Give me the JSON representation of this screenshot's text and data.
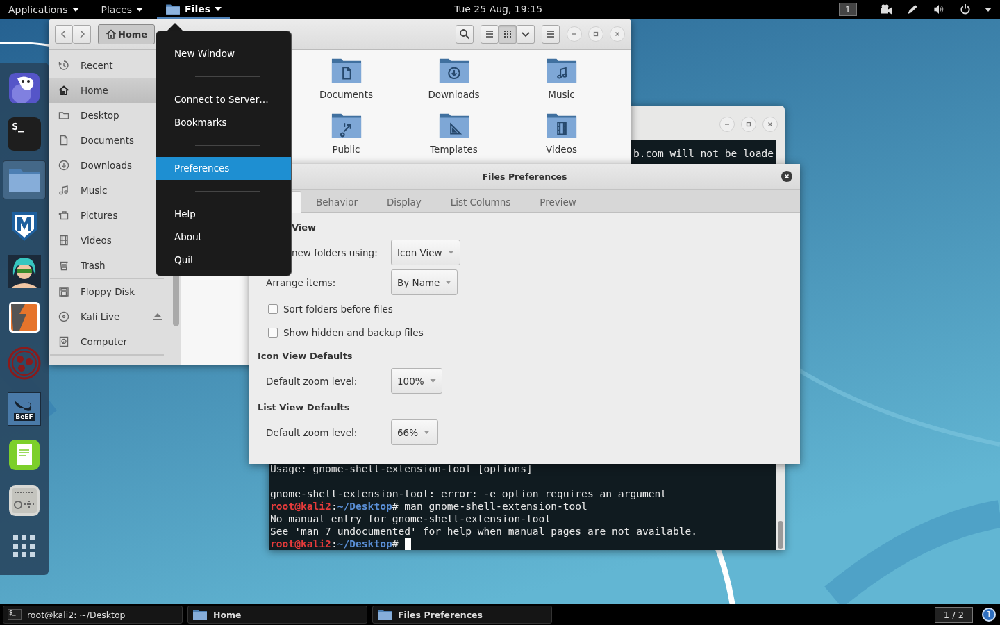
{
  "top_bar": {
    "menus": [
      {
        "label": "Applications",
        "kind": "menu",
        "selected": false
      },
      {
        "label": "Places",
        "kind": "menu",
        "selected": false
      },
      {
        "label": "Files",
        "kind": "app",
        "selected": true
      }
    ],
    "clock": "Tue 25 Aug, 19:15",
    "workspace": "1"
  },
  "dock": {
    "items": [
      {
        "kind": "browser",
        "selected": false
      },
      {
        "kind": "terminal",
        "label": "$_",
        "selected": false
      },
      {
        "kind": "files",
        "selected": true
      },
      {
        "kind": "shield",
        "selected": false
      },
      {
        "kind": "avatar",
        "selected": false
      },
      {
        "kind": "bolt",
        "selected": false
      },
      {
        "kind": "circles",
        "selected": false
      },
      {
        "kind": "bull",
        "label": "BeEF",
        "selected": false
      },
      {
        "kind": "notes",
        "selected": false
      },
      {
        "kind": "radio",
        "selected": false
      },
      {
        "kind": "apps",
        "selected": false
      }
    ]
  },
  "terminal": {
    "top_lines": [
      {
        "text": "b.com will not be loade"
      }
    ],
    "lines": [
      {
        "kind": "output",
        "text": "Usage: gnome-shell-extension-tool [options]"
      },
      {
        "kind": "blank"
      },
      {
        "kind": "output",
        "text": "gnome-shell-extension-tool: error: -e option requires an argument"
      },
      {
        "kind": "prompt",
        "user": "root@kali2",
        "separator": ":",
        "path": "~/Desktop",
        "command": "# man gnome-shell-extension-tool",
        "cursor": false
      },
      {
        "kind": "output",
        "text": "No manual entry for gnome-shell-extension-tool"
      },
      {
        "kind": "output",
        "text": "See 'man 7 undocumented' for help when manual pages are not available."
      },
      {
        "kind": "prompt",
        "user": "root@kali2",
        "separator": ":",
        "path": "~/Desktop",
        "command": "#",
        "cursor": true
      }
    ]
  },
  "files_window": {
    "path": "Home",
    "view_buttons": [
      {
        "kind": "list",
        "selected": false
      },
      {
        "kind": "grid",
        "selected": true
      }
    ],
    "places": [
      {
        "label": "Recent",
        "kind": "recent",
        "selected": false
      },
      {
        "label": "Home",
        "kind": "home",
        "selected": true
      },
      {
        "label": "Desktop",
        "kind": "folder",
        "selected": false
      },
      {
        "label": "Documents",
        "kind": "document",
        "selected": false
      },
      {
        "label": "Downloads",
        "kind": "download",
        "selected": false
      },
      {
        "label": "Music",
        "kind": "music",
        "selected": false
      },
      {
        "label": "Pictures",
        "kind": "pictures",
        "selected": false
      },
      {
        "label": "Videos",
        "kind": "video",
        "selected": false
      },
      {
        "label": "Trash",
        "kind": "trash",
        "selected": false
      }
    ],
    "devices": [
      {
        "label": "Floppy Disk",
        "kind": "floppy",
        "selected": false,
        "ejectable": false
      },
      {
        "label": "Kali Live",
        "kind": "disc",
        "selected": false,
        "ejectable": true
      },
      {
        "label": "Computer",
        "kind": "computer",
        "selected": false,
        "ejectable": false
      }
    ],
    "folders": [
      {
        "label": "Documents",
        "kind": "documents"
      },
      {
        "label": "Downloads",
        "kind": "downloads"
      },
      {
        "label": "Music",
        "kind": "music"
      },
      {
        "label": "Public",
        "kind": "public"
      },
      {
        "label": "Templates",
        "kind": "templates"
      },
      {
        "label": "Videos",
        "kind": "videos"
      }
    ]
  },
  "preferences": {
    "title": "Files Preferences",
    "tabs": [
      {
        "selected": true
      },
      {
        "label": "Behavior",
        "selected": false
      },
      {
        "label": "Display",
        "selected": false
      },
      {
        "label": "List Columns",
        "selected": false
      },
      {
        "label": "Preview",
        "selected": false
      }
    ],
    "sections": [
      {
        "heading": "View",
        "clipped": true,
        "rows": [
          {
            "kind": "dropdown",
            "label": "new folders using:",
            "value": "Icon View",
            "clipped": true
          },
          {
            "kind": "dropdown",
            "label": "Arrange items:",
            "value": "By Name",
            "clipped": false
          },
          {
            "kind": "checkbox",
            "label": "Sort folders before files",
            "checked": false
          },
          {
            "kind": "checkbox",
            "label": "Show hidden and backup files",
            "checked": false
          }
        ]
      },
      {
        "heading": "Icon View Defaults",
        "clipped": false,
        "rows": [
          {
            "kind": "dropdown",
            "label": "Default zoom level:",
            "value": "100%",
            "clipped": false
          }
        ]
      },
      {
        "heading": "List View Defaults",
        "clipped": false,
        "rows": [
          {
            "kind": "dropdown",
            "label": "Default zoom level:",
            "value": "66%",
            "clipped": false
          }
        ]
      }
    ]
  },
  "app_menu": {
    "items": [
      {
        "kind": "item",
        "label": "New Window",
        "selected": false
      },
      {
        "kind": "separator"
      },
      {
        "kind": "item",
        "label": "Connect to Server…",
        "selected": false
      },
      {
        "kind": "item",
        "label": "Bookmarks",
        "selected": false
      },
      {
        "kind": "separator"
      },
      {
        "kind": "item",
        "label": "Preferences",
        "selected": true
      },
      {
        "kind": "separator"
      },
      {
        "kind": "item",
        "label": "Help",
        "selected": false
      },
      {
        "kind": "item",
        "label": "About",
        "selected": false
      },
      {
        "kind": "item",
        "label": "Quit",
        "selected": false
      }
    ]
  },
  "taskbar": {
    "tasks": [
      {
        "kind": "terminal",
        "icon_label": "$_",
        "label": "root@kali2: ~/Desktop"
      },
      {
        "kind": "folder",
        "label": "Home"
      },
      {
        "kind": "folder",
        "label": "Files Preferences"
      }
    ],
    "workspace": "1 / 2",
    "notifications": "1"
  }
}
